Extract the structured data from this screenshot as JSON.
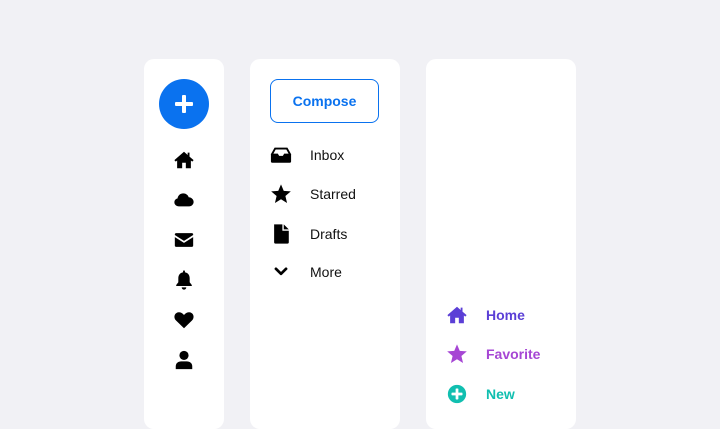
{
  "rail": {
    "fab_icon": "plus-icon",
    "items": [
      {
        "icon": "home-icon"
      },
      {
        "icon": "cloud-icon"
      },
      {
        "icon": "envelope-icon"
      },
      {
        "icon": "bell-icon"
      },
      {
        "icon": "heart-icon"
      },
      {
        "icon": "user-icon"
      }
    ]
  },
  "nav": {
    "compose_label": "Compose",
    "items": [
      {
        "label": "Inbox",
        "icon": "inbox-icon"
      },
      {
        "label": "Starred",
        "icon": "star-icon"
      },
      {
        "label": "Drafts",
        "icon": "file-icon"
      },
      {
        "label": "More",
        "icon": "chevron-down-icon"
      }
    ]
  },
  "right": {
    "items": [
      {
        "label": "Home",
        "icon": "home-icon",
        "color": "#5b3fd6"
      },
      {
        "label": "Favorite",
        "icon": "star-icon",
        "color": "#a646d4"
      },
      {
        "label": "New",
        "icon": "plus-circle-icon",
        "color": "#11bfb0"
      }
    ]
  },
  "colors": {
    "accent": "#0a72ef",
    "background": "#f1f1f5",
    "panel": "#ffffff"
  }
}
